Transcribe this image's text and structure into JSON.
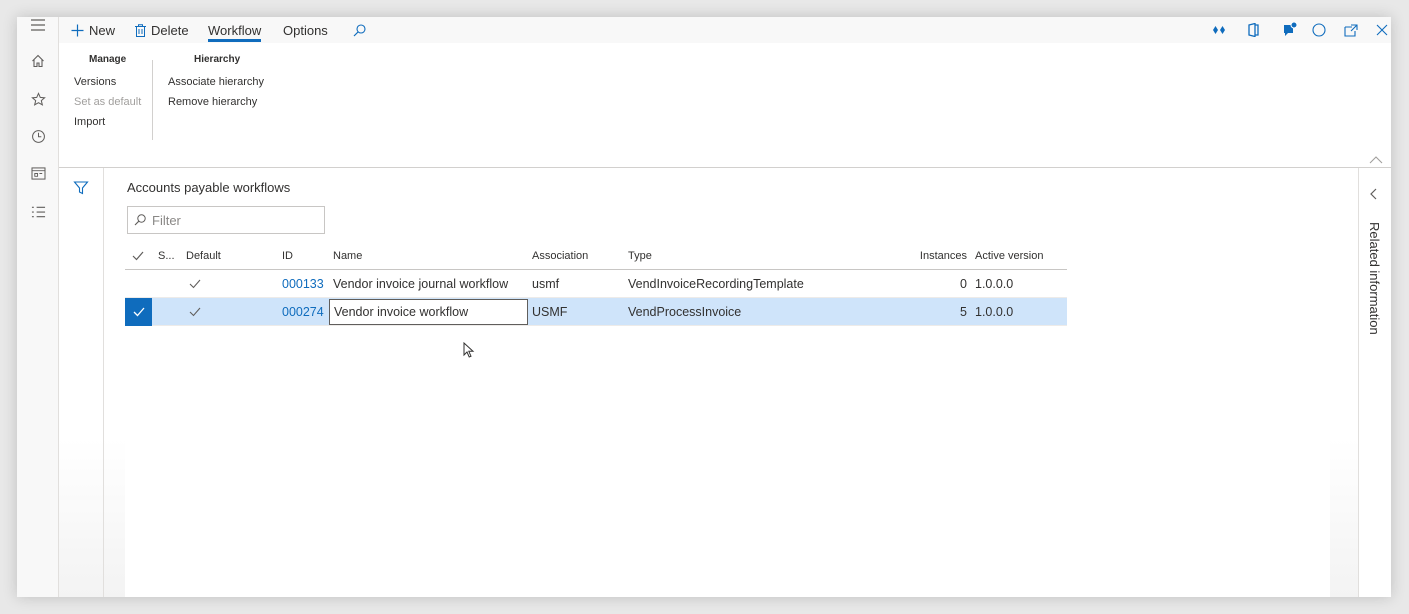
{
  "action_bar": {
    "new_label": "New",
    "delete_label": "Delete",
    "tabs": [
      {
        "label": "Workflow",
        "active": true
      },
      {
        "label": "Options",
        "active": false
      }
    ]
  },
  "ribbon": {
    "manage": {
      "title": "Manage",
      "items": [
        {
          "label": "Versions",
          "enabled": true
        },
        {
          "label": "Set as default",
          "enabled": false
        },
        {
          "label": "Import",
          "enabled": true
        }
      ]
    },
    "hierarchy": {
      "title": "Hierarchy",
      "items": [
        {
          "label": "Associate hierarchy",
          "enabled": true
        },
        {
          "label": "Remove hierarchy",
          "enabled": true
        }
      ]
    }
  },
  "page": {
    "title": "Accounts payable workflows",
    "filter_placeholder": "Filter"
  },
  "grid": {
    "columns": {
      "selected": "S...",
      "default": "Default",
      "id": "ID",
      "name": "Name",
      "association": "Association",
      "type": "Type",
      "instances": "Instances",
      "active_version": "Active version"
    },
    "rows": [
      {
        "selected": false,
        "default": true,
        "id": "000133",
        "name": "Vendor invoice journal workflow",
        "association": "usmf",
        "type": "VendInvoiceRecordingTemplate",
        "instances": "0",
        "active_version": "1.0.0.0"
      },
      {
        "selected": true,
        "default": true,
        "id": "000274",
        "name": "Vendor invoice workflow",
        "association": "USMF",
        "type": "VendProcessInvoice",
        "instances": "5",
        "active_version": "1.0.0.0"
      }
    ]
  },
  "related_pane": {
    "label": "Related information"
  },
  "colors": {
    "accent": "#0f6cbd",
    "selected_row": "#cfe4fa"
  },
  "icons": [
    "hamburger-icon",
    "home-icon",
    "star-icon",
    "clock-icon",
    "workspace-icon",
    "list-icon",
    "plus-icon",
    "trash-icon",
    "search-icon",
    "filter-icon",
    "chevron-left-icon",
    "chevron-up-icon",
    "diamond-icon",
    "office-icon",
    "notification-icon",
    "refresh-icon",
    "popout-icon",
    "close-icon"
  ]
}
